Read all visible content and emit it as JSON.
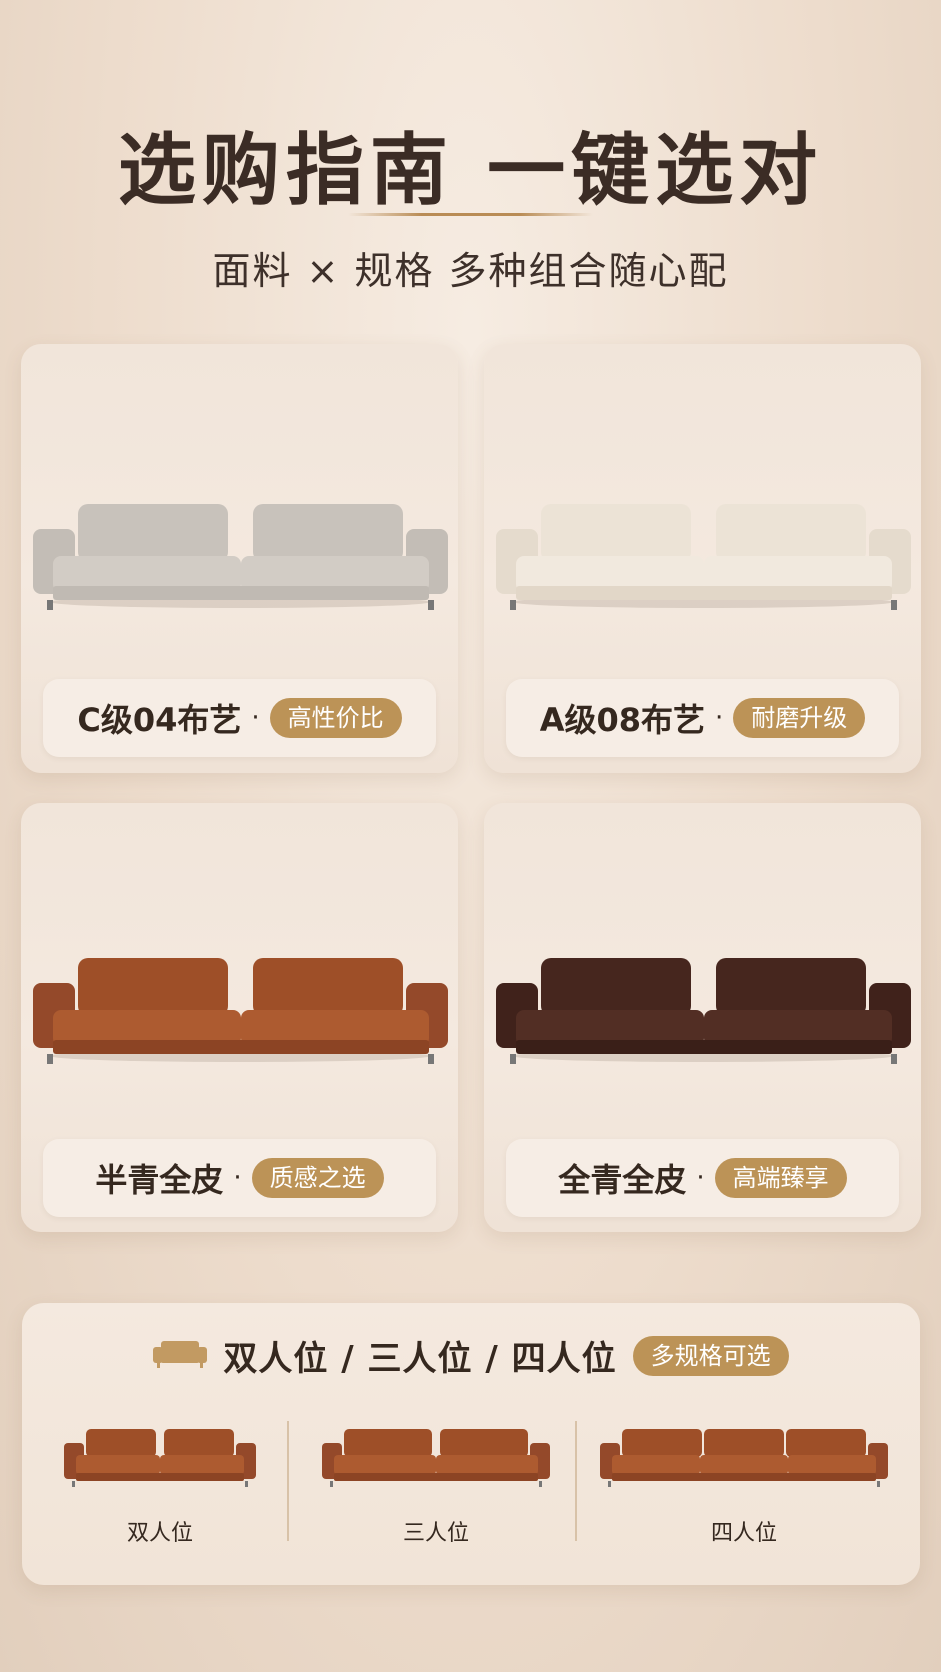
{
  "header": {
    "title": "选购指南 一键选对",
    "subtitle": "面料 × 规格  多种组合随心配"
  },
  "options": [
    {
      "name": "C级04布艺",
      "sep": "·",
      "badge": "高性价比",
      "color": "#cfc9c2",
      "sofa_icon": "gray-fabric-sofa"
    },
    {
      "name": "A级08布艺",
      "sep": "·",
      "badge": "耐磨升级",
      "color": "#eee3d4",
      "sofa_icon": "cream-fabric-sofa"
    },
    {
      "name": "半青全皮",
      "sep": "·",
      "badge": "质感之选",
      "color": "#a9572d",
      "sofa_icon": "tan-leather-sofa"
    },
    {
      "name": "全青全皮",
      "sep": "·",
      "badge": "高端臻享",
      "color": "#4a2a22",
      "sofa_icon": "dark-brown-leather-sofa"
    }
  ],
  "sizes": {
    "title": "双人位 / 三人位 / 四人位",
    "badge": "多规格可选",
    "icon": "sofa-icon",
    "items": [
      {
        "label": "双人位"
      },
      {
        "label": "三人位"
      },
      {
        "label": "四人位"
      }
    ]
  },
  "colors": {
    "accent": "#bc9357",
    "text": "#35281f",
    "leather": "#a9572d"
  }
}
